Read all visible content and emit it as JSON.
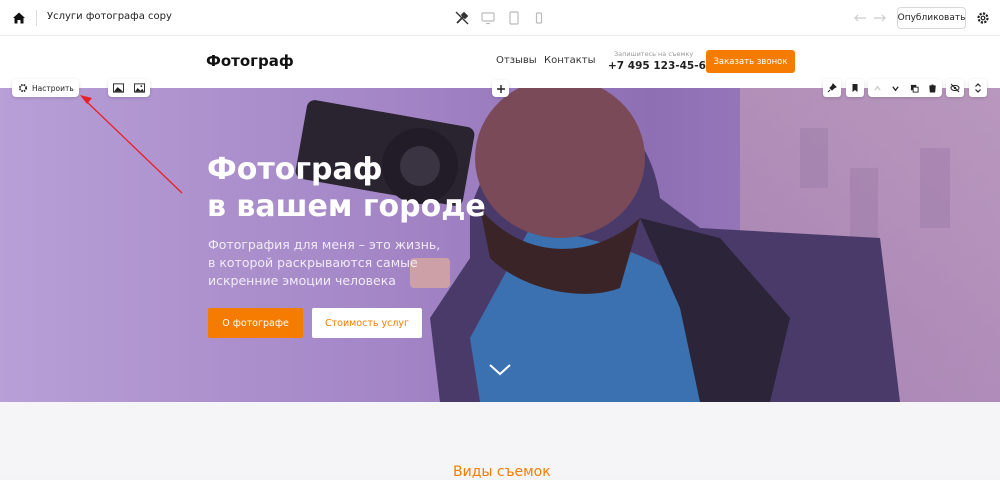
{
  "toolbar": {
    "page_title": "Услуги фотографа copy",
    "publish_label": "Опубликовать",
    "icons": [
      "home-icon",
      "brush-icon",
      "desktop-icon",
      "tablet-icon",
      "mobile-icon",
      "undo-icon",
      "redo-icon",
      "settings-icon"
    ]
  },
  "site_header": {
    "logo": "Фотограф",
    "nav": [
      "Отзывы",
      "Контакты"
    ],
    "call_hint": "Запишитесь на съемку",
    "phone": "+7 495 123-45-67",
    "call_button": "Заказать звонок"
  },
  "hero": {
    "title_line1": "Фотограф",
    "title_line2": "в вашем городе",
    "subtitle_line1": "Фотография для меня – это жизнь,",
    "subtitle_line2": "в которой раскрываются самые",
    "subtitle_line3": "искренние эмоции человека",
    "primary_button": "О фотографе",
    "secondary_button": "Стоимость услуг"
  },
  "editor_controls": {
    "configure_label": "Настроить"
  },
  "next_section": {
    "title": "Виды съемок"
  },
  "colors": {
    "accent": "#f57c00",
    "hero_overlay": "#a385c6"
  }
}
